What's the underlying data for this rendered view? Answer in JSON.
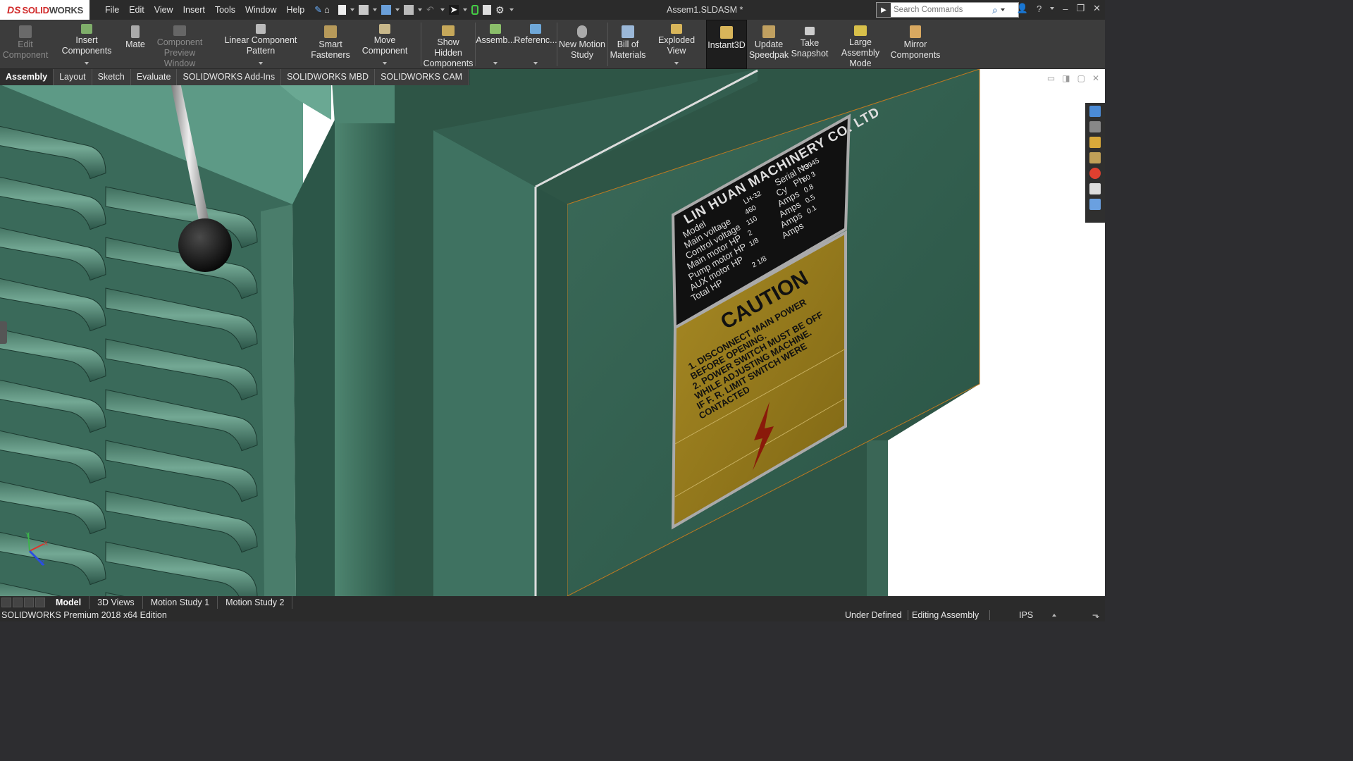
{
  "app": {
    "logo_ds": "DS",
    "logo_solid": "SOLID",
    "logo_works": "WORKS",
    "document_title": "Assem1.SLDASM *"
  },
  "menu": [
    "File",
    "Edit",
    "View",
    "Insert",
    "Tools",
    "Window",
    "Help"
  ],
  "search": {
    "placeholder": "Search Commands"
  },
  "ribbon": {
    "edit_component": "Edit\nComponent",
    "insert_components": "Insert Components",
    "mate": "Mate",
    "component_preview": "Component\nPreview Window",
    "linear_pattern": "Linear Component Pattern",
    "smart_fasteners": "Smart\nFasteners",
    "move_component": "Move Component",
    "show_hidden": "Show Hidden\nComponents",
    "assembly_features": "Assemb...",
    "reference_geometry": "Referenc...",
    "new_motion_study": "New Motion\nStudy",
    "bill_of_materials": "Bill of\nMaterials",
    "exploded_view": "Exploded View",
    "instant3d": "Instant3D",
    "update_speedpak": "Update\nSpeedpak",
    "take_snapshot": "Take\nSnapshot",
    "large_assembly_mode": "Large Assembly\nMode",
    "mirror_components": "Mirror\nComponents"
  },
  "tabs": [
    "Assembly",
    "Layout",
    "Sketch",
    "Evaluate",
    "SOLIDWORKS Add-Ins",
    "SOLIDWORKS MBD",
    "SOLIDWORKS CAM"
  ],
  "nameplate": {
    "company": "LIN HUAN MACHINERY CO. LTD",
    "rows": [
      {
        "label": "Model",
        "value": "LH-32",
        "label2": "Serial No",
        "value2": "73945"
      },
      {
        "label": "Main voltage",
        "value": "460",
        "label2": "Cy",
        "value2": "60",
        "label3": "Ph",
        "value3": "3"
      },
      {
        "label": "Control voltage",
        "value": "110",
        "label2": "Amps",
        "value2": "0.8"
      },
      {
        "label": "Main motor HP",
        "value": "2",
        "label2": "Amps",
        "value2": "0.5"
      },
      {
        "label": "Pump motor HP",
        "value": "1/8",
        "label2": "Amps",
        "value2": "0.1"
      },
      {
        "label": "AUX motor HP",
        "value": "",
        "label2": "Amps",
        "value2": ""
      },
      {
        "label": "Total HP",
        "value": "2 1/8",
        "label2": "",
        "value2": ""
      }
    ],
    "caution_title": "CAUTION",
    "caution_lines": [
      "1. DISCONNECT MAIN POWER",
      "BEFORE OPENING.",
      "2. POWER SWITCH MUST BE OFF",
      "WHILE ADJUSTING MACHINE.",
      "IF F. R. LIMIT SWITCH WERE",
      "CONTACTED"
    ]
  },
  "triad": {
    "x": "X",
    "y": "Y",
    "z": "Z"
  },
  "bottom_tabs": [
    "Model",
    "3D Views",
    "Motion Study 1",
    "Motion Study 2"
  ],
  "status": {
    "edition": "SOLIDWORKS Premium 2018 x64 Edition",
    "definition": "Under Defined",
    "mode": "Editing Assembly",
    "units": "IPS"
  },
  "colors": {
    "brand_red": "#d12a2a",
    "panel_green": "#2f5b4b",
    "plate_black": "#111111",
    "caution_yellow": "#9a7e1c",
    "ui_dark": "#2b2b2b"
  }
}
